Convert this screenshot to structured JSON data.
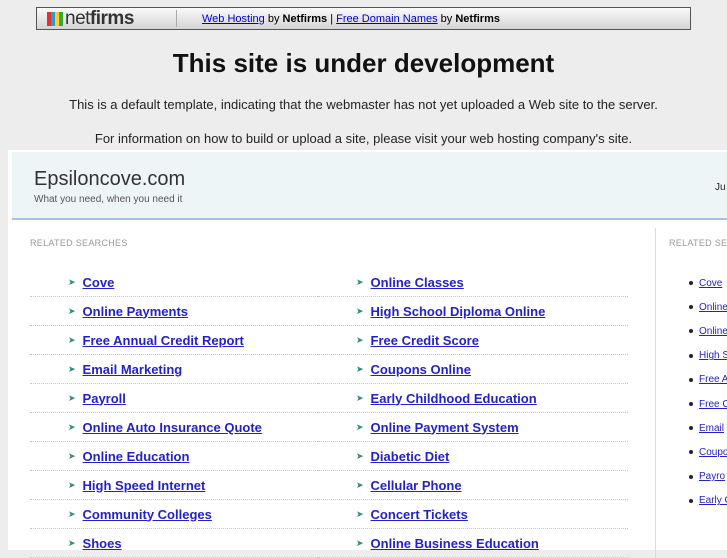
{
  "topbar": {
    "logo": "netfirms",
    "link1": "Web Hosting",
    "by1": " by ",
    "brand1": "Netfirms",
    "sep": " | ",
    "link2": "Free Domain Names",
    "by2": " by ",
    "brand2": "Netfirms"
  },
  "title": "This site is under development",
  "msg1": "This is a default template, indicating that the webmaster has not yet uploaded a Web site to the server.",
  "msg2": "For information on how to build or upload a site, please visit your web hosting company's site.",
  "site": {
    "name": "Epsiloncove.com",
    "tagline": "What you need, when you need it",
    "right_text": "Ju"
  },
  "related_label": "RELATED SEARCHES",
  "left_col": [
    "Cove",
    "Online Payments",
    "Free Annual Credit Report",
    "Email Marketing",
    "Payroll",
    "Online Auto Insurance Quote",
    "Online Education",
    "High Speed Internet",
    "Community Colleges",
    "Shoes"
  ],
  "right_col": [
    "Online Classes",
    "High School Diploma Online",
    "Free Credit Score",
    "Coupons Online",
    "Early Childhood Education",
    "Online Payment System",
    "Diabetic Diet",
    "Cellular Phone",
    "Concert Tickets",
    "Online Business Education"
  ],
  "sidebar_label": "RELATED SE",
  "sidebar": [
    "Cove",
    "Online",
    "Online",
    "High S",
    "Free A",
    "Free C",
    "Email",
    "Coupo",
    "Payro",
    "Early C"
  ]
}
